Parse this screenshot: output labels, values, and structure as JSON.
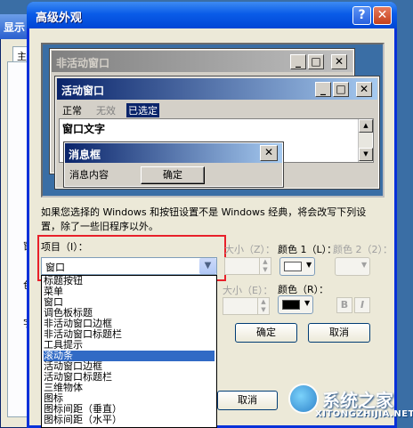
{
  "background_window": {
    "title": "显示",
    "tab_label": "主题",
    "fragments": [
      "窗",
      "色",
      "字"
    ]
  },
  "dialog": {
    "title": "高级外观",
    "help_button": "?",
    "close_button": "✕"
  },
  "preview": {
    "inactive_window_title": "非活动窗口",
    "active_window_title": "活动窗口",
    "menu": {
      "normal": "正常",
      "disabled": "无效",
      "selected": "已选定"
    },
    "window_text": "窗口文字",
    "message_box": {
      "title": "消息框",
      "content": "消息内容",
      "ok_button": "确定"
    }
  },
  "warning_text": "如果您选择的 Windows 和按钮设置不是 Windows 经典，将会改写下列设置，除了一些旧程序以外。",
  "item": {
    "label": "项目（I）：",
    "selected_value": "窗口",
    "options": [
      "标题按钮",
      "菜单",
      "窗口",
      "调色板标题",
      "非活动窗口边框",
      "非活动窗口标题栏",
      "工具提示",
      "滚动条",
      "活动窗口边框",
      "活动窗口标题栏",
      "三维物体",
      "图标",
      "图标间距（垂直）",
      "图标间距（水平）"
    ],
    "highlighted_option": "滚动条"
  },
  "size_label_1": "大小（Z）：",
  "color1_label": "颜色 1（L）：",
  "color2_label": "颜色 2（2）：",
  "font_size_label": "大小（E）：",
  "font_color_label": "颜色（R）：",
  "bold_button": "B",
  "italic_button": "I",
  "ok_button": "确定",
  "cancel_button": "取消",
  "bg_cancel_button": "取消",
  "colors": {
    "color1": "#ffffff",
    "font_color": "#000000"
  },
  "watermark": {
    "text": "系统之家",
    "url": "XITONGZHIJIA.NET"
  }
}
